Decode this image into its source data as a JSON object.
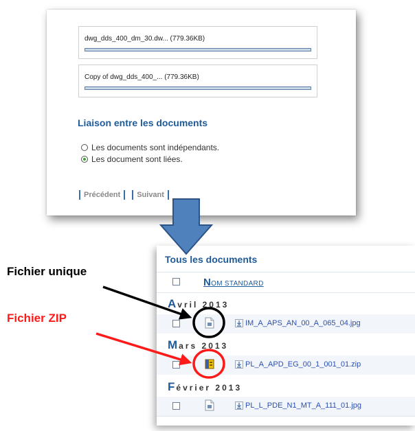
{
  "upload": {
    "files": [
      {
        "label": "dwg_dds_400_dm_30.dw... (779.36KB)",
        "progress": 1.0
      },
      {
        "label": "Copy of dwg_dds_400_... (779.36KB)",
        "progress": 1.0
      }
    ],
    "section_title": "Liaison entre les documents",
    "options": [
      {
        "label": "Les documents sont indépendants.",
        "checked": false
      },
      {
        "label": "Les document sont liées.",
        "checked": true
      }
    ],
    "prev_label": "Précédent",
    "next_label": "Suivant"
  },
  "documents": {
    "title": "Tous les documents",
    "column_initial": "N",
    "column_rest": "OM STANDARD",
    "groups": [
      {
        "initial": "A",
        "rest": "vril 2013",
        "file": "IM_A_APS_AN_00_A_065_04.jpg",
        "type": "single"
      },
      {
        "initial": "M",
        "rest": "ars 2013",
        "file": "PL_A_APD_EG_00_1_001_01.zip",
        "type": "zip"
      },
      {
        "initial": "F",
        "rest": "évrier 2013",
        "file": "PL_L_PDE_N1_MT_A_111_01.jpg",
        "type": "single"
      }
    ]
  },
  "annotations": {
    "single_file": "Fichier unique",
    "zip_file": "Fichier ZIP"
  },
  "colors": {
    "accent_blue": "#1f5a99",
    "link_blue": "#2b4fb3",
    "annotation_red": "#ff1a1a",
    "arrow_fill": "#4f81bd"
  }
}
